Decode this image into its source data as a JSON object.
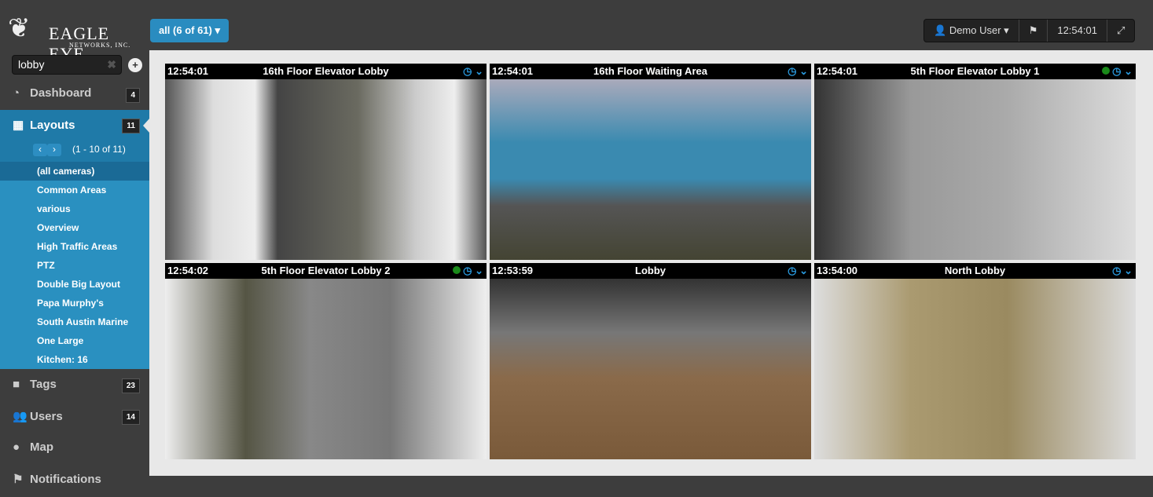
{
  "brand": {
    "line1": "EAGLE EYE",
    "line2": "NETWORKS, INC."
  },
  "search": {
    "value": "lobby"
  },
  "nav": {
    "dashboard": {
      "label": "Dashboard",
      "count": "4"
    },
    "layouts": {
      "label": "Layouts",
      "count": "11",
      "pager": "(1 - 10 of 11)",
      "items": [
        "(all cameras)",
        "Common Areas",
        "various",
        "Overview",
        "High Traffic Areas",
        "PTZ",
        "Double Big Layout",
        "Papa Murphy's",
        "South Austin Marine",
        "One Large",
        "Kitchen: 16"
      ]
    },
    "tags": {
      "label": "Tags",
      "count": "23"
    },
    "users": {
      "label": "Users",
      "count": "14"
    },
    "map": {
      "label": "Map"
    },
    "notifications": {
      "label": "Notifications"
    }
  },
  "filter": {
    "label": "all (6 of 61) ▾"
  },
  "topbar": {
    "user": "Demo User ▾",
    "time": "12:54:01"
  },
  "cameras": [
    {
      "time": "12:54:01",
      "name": "16th Floor Elevator Lobby",
      "online": false
    },
    {
      "time": "12:54:01",
      "name": "16th Floor Waiting Area",
      "online": false
    },
    {
      "time": "12:54:01",
      "name": "5th Floor Elevator Lobby 1",
      "online": true
    },
    {
      "time": "12:54:02",
      "name": "5th Floor Elevator Lobby 2",
      "online": true
    },
    {
      "time": "12:53:59",
      "name": "Lobby",
      "online": false
    },
    {
      "time": "13:54:00",
      "name": "North Lobby",
      "online": false
    }
  ]
}
